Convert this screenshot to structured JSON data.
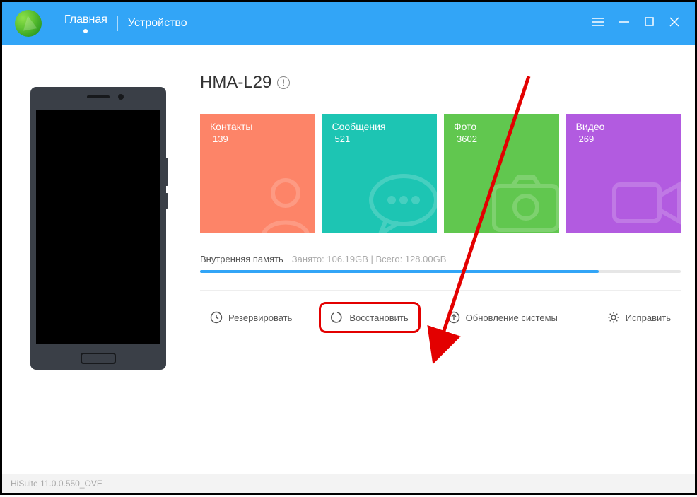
{
  "header": {
    "tabs": {
      "home": "Главная",
      "device": "Устройство"
    }
  },
  "device": {
    "model": "HMA-L29"
  },
  "tiles": {
    "contacts": {
      "label": "Контакты",
      "count": "139"
    },
    "messages": {
      "label": "Сообщения",
      "count": "521"
    },
    "photos": {
      "label": "Фото",
      "count": "3602"
    },
    "video": {
      "label": "Видео",
      "count": "269"
    }
  },
  "storage": {
    "title": "Внутренняя память",
    "usage": "Занято: 106.19GB | Всего: 128.00GB"
  },
  "actions": {
    "backup": "Резервировать",
    "restore": "Восстановить",
    "update": "Обновление системы",
    "fix": "Исправить"
  },
  "footer": {
    "version": "HiSuite 11.0.0.550_OVE"
  }
}
